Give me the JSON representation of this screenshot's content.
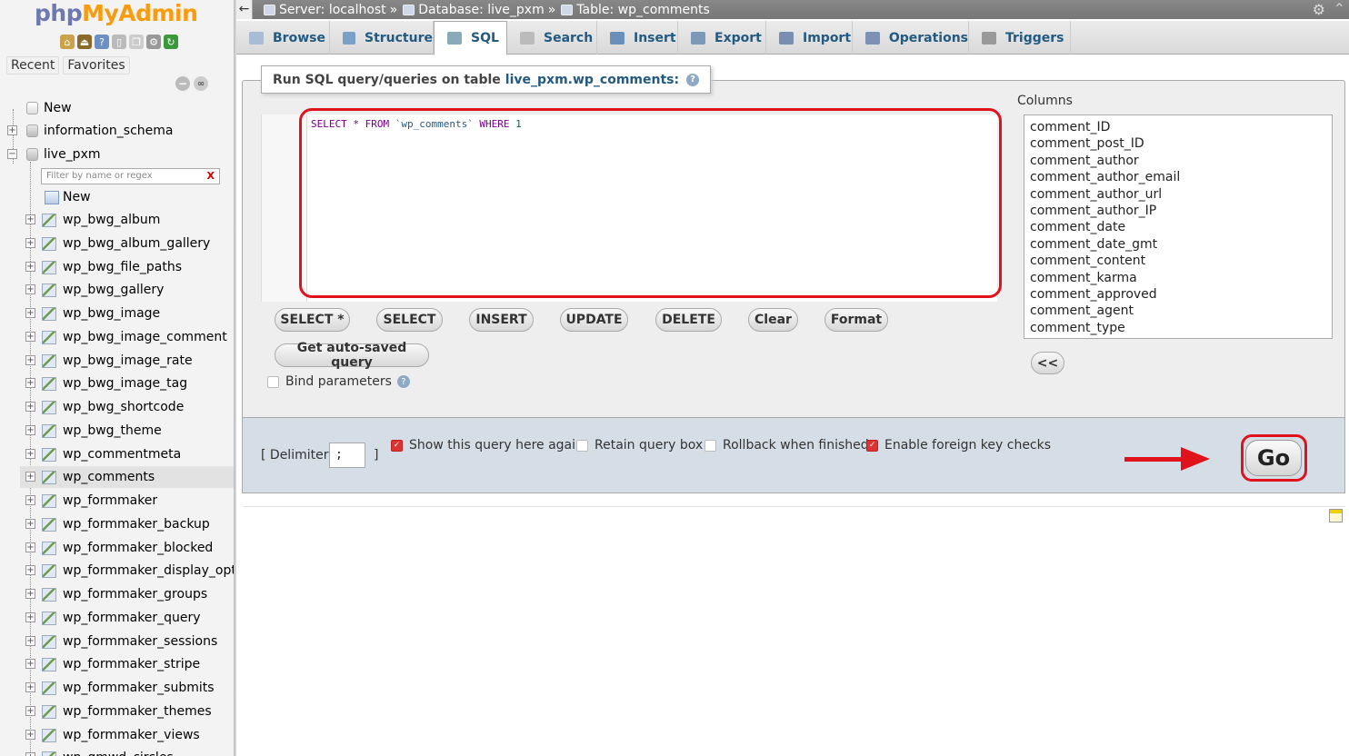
{
  "app": {
    "logo_php": "php",
    "logo_rest": "MyAdmin"
  },
  "sidebar": {
    "recent_label": "Recent",
    "favorites_label": "Favorites",
    "filter_placeholder": "Filter by name or regex",
    "filter_clear": "X",
    "root_new": "New",
    "databases": [
      "information_schema",
      "live_pxm"
    ],
    "table_new": "New",
    "tables": [
      "wp_bwg_album",
      "wp_bwg_album_gallery",
      "wp_bwg_file_paths",
      "wp_bwg_gallery",
      "wp_bwg_image",
      "wp_bwg_image_comment",
      "wp_bwg_image_rate",
      "wp_bwg_image_tag",
      "wp_bwg_shortcode",
      "wp_bwg_theme",
      "wp_commentmeta",
      "wp_comments",
      "wp_formmaker",
      "wp_formmaker_backup",
      "wp_formmaker_blocked",
      "wp_formmaker_display_options",
      "wp_formmaker_groups",
      "wp_formmaker_query",
      "wp_formmaker_sessions",
      "wp_formmaker_stripe",
      "wp_formmaker_submits",
      "wp_formmaker_themes",
      "wp_formmaker_views",
      "wp_gmwd_circles"
    ],
    "selected_table": "wp_comments"
  },
  "breadcrumb": {
    "server": "Server: localhost",
    "database": "Database: live_pxm",
    "table": "Table: wp_comments",
    "separator": "»"
  },
  "tabs": [
    {
      "label": "Browse",
      "icon": "browse-icon"
    },
    {
      "label": "Structure",
      "icon": "structure-icon"
    },
    {
      "label": "SQL",
      "icon": "sql-icon",
      "active": true
    },
    {
      "label": "Search",
      "icon": "search-icon"
    },
    {
      "label": "Insert",
      "icon": "insert-icon"
    },
    {
      "label": "Export",
      "icon": "export-icon"
    },
    {
      "label": "Import",
      "icon": "import-icon"
    },
    {
      "label": "Operations",
      "icon": "wrench-icon"
    },
    {
      "label": "Triggers",
      "icon": "triggers-icon"
    }
  ],
  "sql": {
    "legend_prefix": "Run SQL query/queries on table",
    "legend_table": "live_pxm.wp_comments:",
    "query_keyword1": "SELECT * FROM ",
    "query_table": "`wp_comments`",
    "query_keyword2": " WHERE ",
    "query_value": "1",
    "buttons": [
      "SELECT *",
      "SELECT",
      "INSERT",
      "UPDATE",
      "DELETE",
      "Clear",
      "Format"
    ],
    "autosaved_button": "Get auto-saved query",
    "bind_params_label": "Bind parameters"
  },
  "columns": {
    "label": "Columns",
    "items": [
      "comment_ID",
      "comment_post_ID",
      "comment_author",
      "comment_author_email",
      "comment_author_url",
      "comment_author_IP",
      "comment_date",
      "comment_date_gmt",
      "comment_content",
      "comment_karma",
      "comment_approved",
      "comment_agent",
      "comment_type"
    ],
    "insert_button": "<<"
  },
  "options": {
    "delimiter_open": "[ Delimiter",
    "delimiter_value": ";",
    "delimiter_close": "]",
    "show_query_again": "Show this query here again",
    "show_query_again_checked": true,
    "retain_query_box": "Retain query box",
    "retain_query_box_checked": false,
    "rollback": "Rollback when finished",
    "rollback_checked": false,
    "foreign_key_checks": "Enable foreign key checks",
    "foreign_key_checks_checked": true,
    "go_button": "Go"
  },
  "colors": {
    "accent": "#235a81",
    "highlight": "#e0131d",
    "logo_php": "#6c78af",
    "logo_admin": "#f89c0e"
  }
}
